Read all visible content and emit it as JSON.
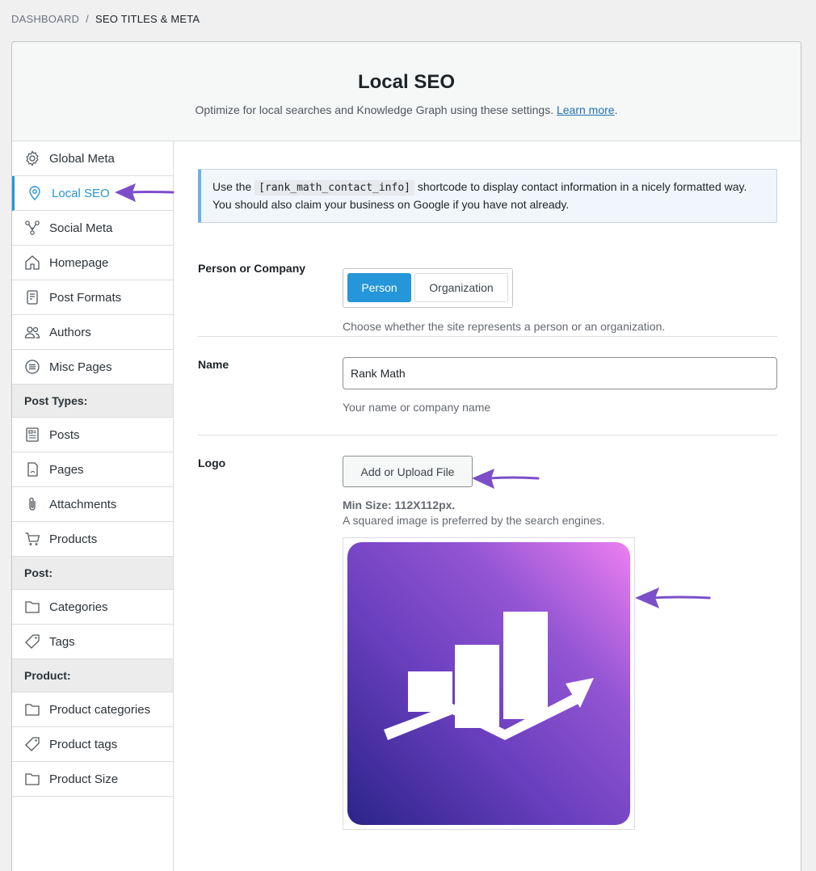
{
  "breadcrumb": {
    "dashboard": "DASHBOARD",
    "separator": "/",
    "current": "SEO TITLES & META"
  },
  "header": {
    "title": "Local SEO",
    "description": "Optimize for local searches and Knowledge Graph using these settings.",
    "learn_more": "Learn more",
    "period": "."
  },
  "sidebar": {
    "items": [
      {
        "label": "Global Meta",
        "icon": "gear-icon"
      },
      {
        "label": "Local SEO",
        "icon": "location-pin-icon",
        "active": true
      },
      {
        "label": "Social Meta",
        "icon": "share-nodes-icon"
      },
      {
        "label": "Homepage",
        "icon": "home-icon"
      },
      {
        "label": "Post Formats",
        "icon": "document-icon"
      },
      {
        "label": "Authors",
        "icon": "users-icon"
      },
      {
        "label": "Misc Pages",
        "icon": "list-circle-icon"
      }
    ],
    "post_types_heading": "Post Types:",
    "post_types": [
      {
        "label": "Posts",
        "icon": "posts-icon"
      },
      {
        "label": "Pages",
        "icon": "page-icon"
      },
      {
        "label": "Attachments",
        "icon": "paperclip-icon"
      },
      {
        "label": "Products",
        "icon": "cart-icon"
      }
    ],
    "post_heading": "Post:",
    "post": [
      {
        "label": "Categories",
        "icon": "folder-icon"
      },
      {
        "label": "Tags",
        "icon": "tag-icon"
      }
    ],
    "product_heading": "Product:",
    "product": [
      {
        "label": "Product categories",
        "icon": "folder-icon"
      },
      {
        "label": "Product tags",
        "icon": "tag-icon"
      },
      {
        "label": "Product Size",
        "icon": "folder-icon"
      }
    ]
  },
  "notice": {
    "before": "Use the ",
    "code": "[rank_math_contact_info]",
    "after": " shortcode to display contact information in a nicely formatted way. You should also claim your business on Google if you have not already."
  },
  "person_or_company": {
    "label": "Person or Company",
    "options": [
      "Person",
      "Organization"
    ],
    "selected": "Person",
    "help": "Choose whether the site represents a person or an organization."
  },
  "name_field": {
    "label": "Name",
    "value": "Rank Math",
    "help": "Your name or company name"
  },
  "logo_field": {
    "label": "Logo",
    "button": "Add or Upload File",
    "min_size": "Min Size: 112X112px.",
    "help": "A squared image is preferred by the search engines."
  },
  "colors": {
    "accent": "#2596d9",
    "annotation_arrow": "#7b4fc9"
  }
}
